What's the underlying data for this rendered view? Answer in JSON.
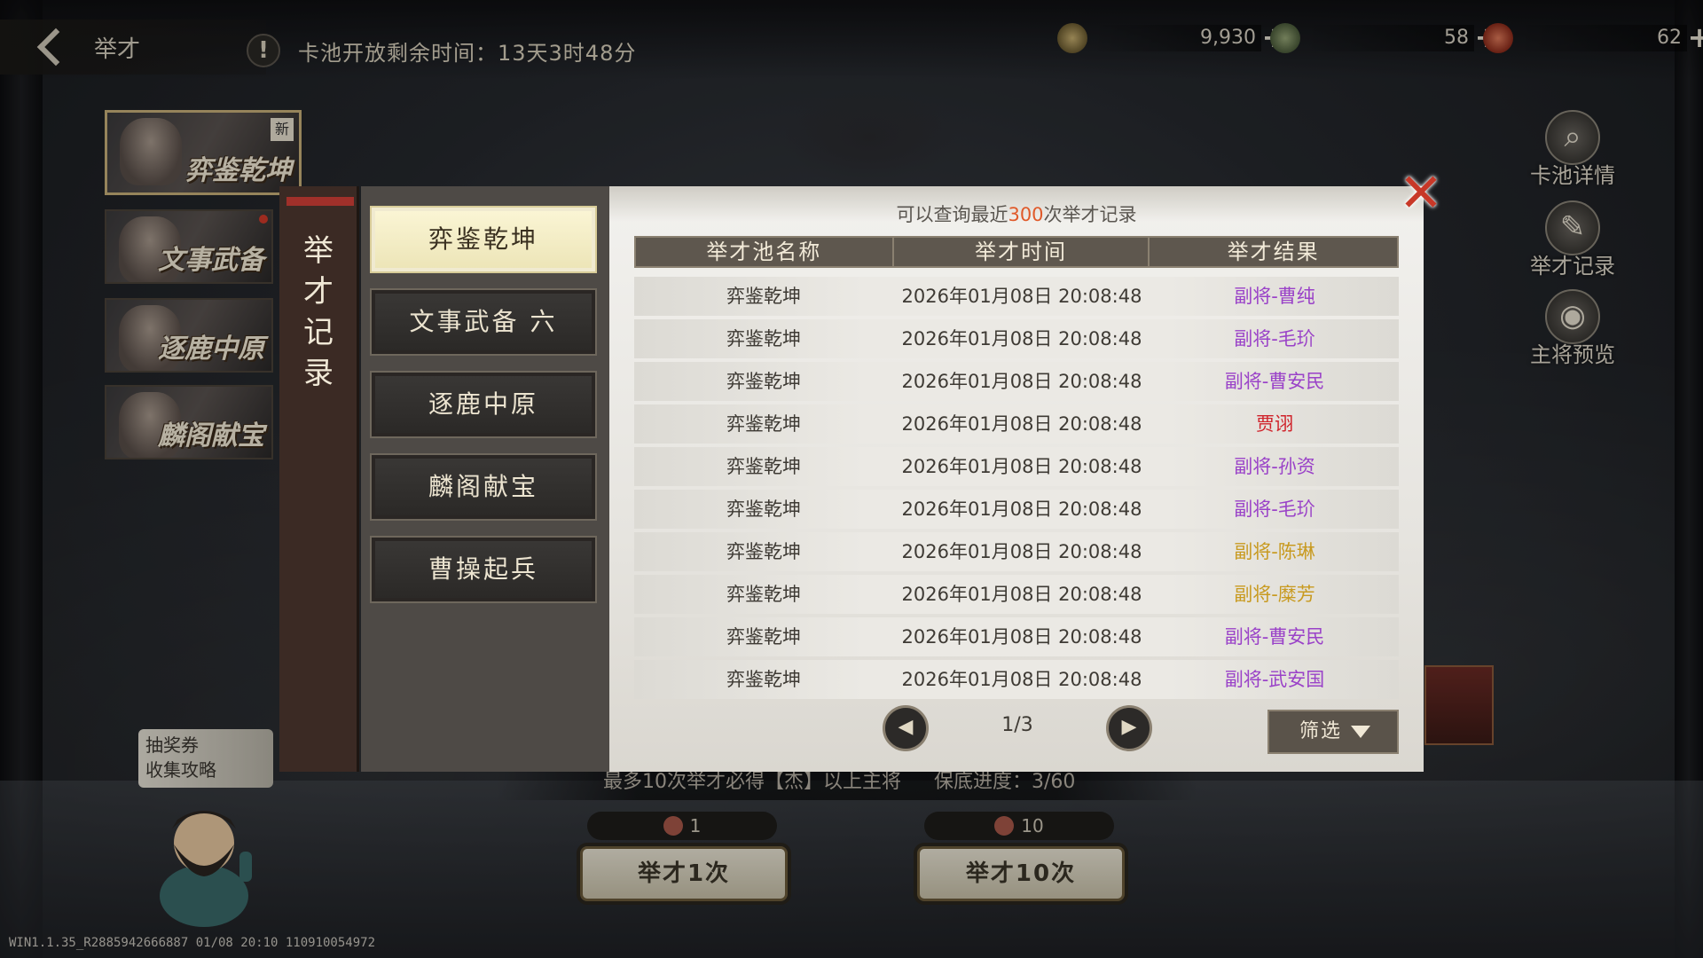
{
  "header": {
    "back_label": "举才",
    "warning_glyph": "!",
    "pool_timer": "卡池开放剩余时间：13天3时48分"
  },
  "currencies": [
    {
      "icon": "coin-icon",
      "value": "9,930",
      "color": "#8a7a4a"
    },
    {
      "icon": "jade-icon",
      "value": "58",
      "color": "#5a6a4a"
    },
    {
      "icon": "gem-icon",
      "value": "62",
      "color": "#a84a3a"
    }
  ],
  "banners": [
    {
      "title": "弈鉴乾坤",
      "new_tag": "新",
      "active": true
    },
    {
      "title": "文事武备",
      "red_dot": true
    },
    {
      "title": "逐鹿中原"
    },
    {
      "title": "麟阁献宝"
    }
  ],
  "ticket_guide": {
    "line1": "抽奖券",
    "line2": "收集攻略"
  },
  "version": "WIN1.1.35_R2885942666887 01/08 20:10 110910054972",
  "side_menu": [
    {
      "label": "卡池详情",
      "icon": "magnifier-icon",
      "glyph": "⌕"
    },
    {
      "label": "举才记录",
      "icon": "brush-icon",
      "glyph": "✎"
    },
    {
      "label": "主将预览",
      "icon": "helmet-icon",
      "glyph": "◉"
    }
  ],
  "draw": {
    "guarantee_text": "最多10次举才必得【杰】以上主将",
    "progress_text": "保底进度：3/60",
    "single_cost": "1",
    "ten_cost": "10",
    "single_label": "举才1次",
    "ten_label": "举才10次"
  },
  "modal": {
    "side_title": [
      "举",
      "才",
      "记",
      "录"
    ],
    "pools": [
      "弈鉴乾坤",
      "文事武备 六",
      "逐鹿中原",
      "麟阁献宝",
      "曹操起兵"
    ],
    "selected_pool": 0,
    "hint_prefix": "可以查询最近",
    "hint_num": "300",
    "hint_suffix": "次举才记录",
    "columns": [
      "举才池名称",
      "举才时间",
      "举才结果"
    ],
    "rows": [
      {
        "pool": "弈鉴乾坤",
        "time": "2026年01月08日 20:08:48",
        "result": "副将-曹纯",
        "tier": "purple"
      },
      {
        "pool": "弈鉴乾坤",
        "time": "2026年01月08日 20:08:48",
        "result": "副将-毛玠",
        "tier": "purple"
      },
      {
        "pool": "弈鉴乾坤",
        "time": "2026年01月08日 20:08:48",
        "result": "副将-曹安民",
        "tier": "purple"
      },
      {
        "pool": "弈鉴乾坤",
        "time": "2026年01月08日 20:08:48",
        "result": "贾诩",
        "tier": "red"
      },
      {
        "pool": "弈鉴乾坤",
        "time": "2026年01月08日 20:08:48",
        "result": "副将-孙资",
        "tier": "purple"
      },
      {
        "pool": "弈鉴乾坤",
        "time": "2026年01月08日 20:08:48",
        "result": "副将-毛玠",
        "tier": "purple"
      },
      {
        "pool": "弈鉴乾坤",
        "time": "2026年01月08日 20:08:48",
        "result": "副将-陈琳",
        "tier": "gold"
      },
      {
        "pool": "弈鉴乾坤",
        "time": "2026年01月08日 20:08:48",
        "result": "副将-糜芳",
        "tier": "gold"
      },
      {
        "pool": "弈鉴乾坤",
        "time": "2026年01月08日 20:08:48",
        "result": "副将-曹安民",
        "tier": "purple"
      },
      {
        "pool": "弈鉴乾坤",
        "time": "2026年01月08日 20:08:48",
        "result": "副将-武安国",
        "tier": "purple"
      }
    ],
    "page": "1/3",
    "filter_label": "筛选",
    "close_glyph": "✕"
  }
}
